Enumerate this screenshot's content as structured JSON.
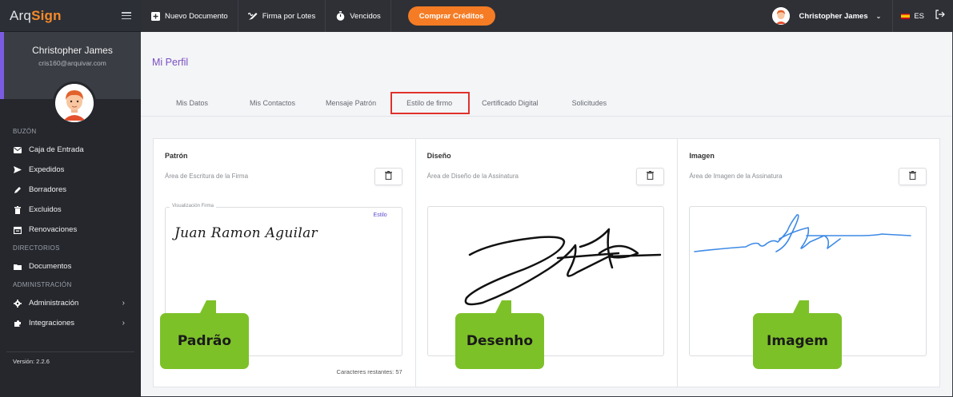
{
  "brand": {
    "part1": "Arq",
    "part2": "Sign"
  },
  "user": {
    "name": "Christopher James",
    "email": "cris160@arquivar.com"
  },
  "sidebar": {
    "sections": {
      "buzon": "BUZÓN",
      "directorios": "DIRECTORIOS",
      "administracion": "ADMINISTRACIÓN"
    },
    "items": [
      {
        "label": "Caja de Entrada",
        "icon": "mail-icon"
      },
      {
        "label": "Expedidos",
        "icon": "send-icon"
      },
      {
        "label": "Borradores",
        "icon": "pencil-icon"
      },
      {
        "label": "Excluidos",
        "icon": "trash-icon"
      },
      {
        "label": "Renovaciones",
        "icon": "calendar-icon"
      },
      {
        "label": "Documentos",
        "icon": "folder-icon"
      },
      {
        "label": "Administración",
        "icon": "gear-icon",
        "chevron": "›"
      },
      {
        "label": "Integraciones",
        "icon": "puzzle-icon",
        "chevron": "›"
      }
    ],
    "version": "Versión: 2.2.6"
  },
  "topbar": {
    "new_doc": "Nuevo Documento",
    "batch_sign": "Firma por Lotes",
    "expired": "Vencidos",
    "buy_credits": "Comprar Créditos",
    "user_name": "Christopher James",
    "lang": "ES"
  },
  "page": {
    "title": "Mi Perfil",
    "tabs": [
      "Mis Datos",
      "Mis Contactos",
      "Mensaje Patrón",
      "Estilo de firmo",
      "Certificado Digital",
      "Solicitudes"
    ],
    "active_tab": 3
  },
  "panels": {
    "patron": {
      "title": "Patrón",
      "subtitle": "Área de Escritura de la Firma",
      "field_label": "Visualización Firma",
      "style_link": "Estilo",
      "signature_text": "Juan Ramon Aguilar",
      "chars_left": "Caracteres restantes: 57"
    },
    "diseno": {
      "title": "Diseño",
      "subtitle": "Área de Diseño de la Assinatura"
    },
    "imagen": {
      "title": "Imagen",
      "subtitle": "Área de Imagen de la Assinatura"
    }
  },
  "callouts": [
    "Padrão",
    "Desenho",
    "Imagem"
  ],
  "colors": {
    "accent": "#7a4fc0",
    "orange": "#f57c24",
    "callout": "#7dc129",
    "active_tab_border": "#e0312c",
    "sidebar": "#25272d"
  }
}
